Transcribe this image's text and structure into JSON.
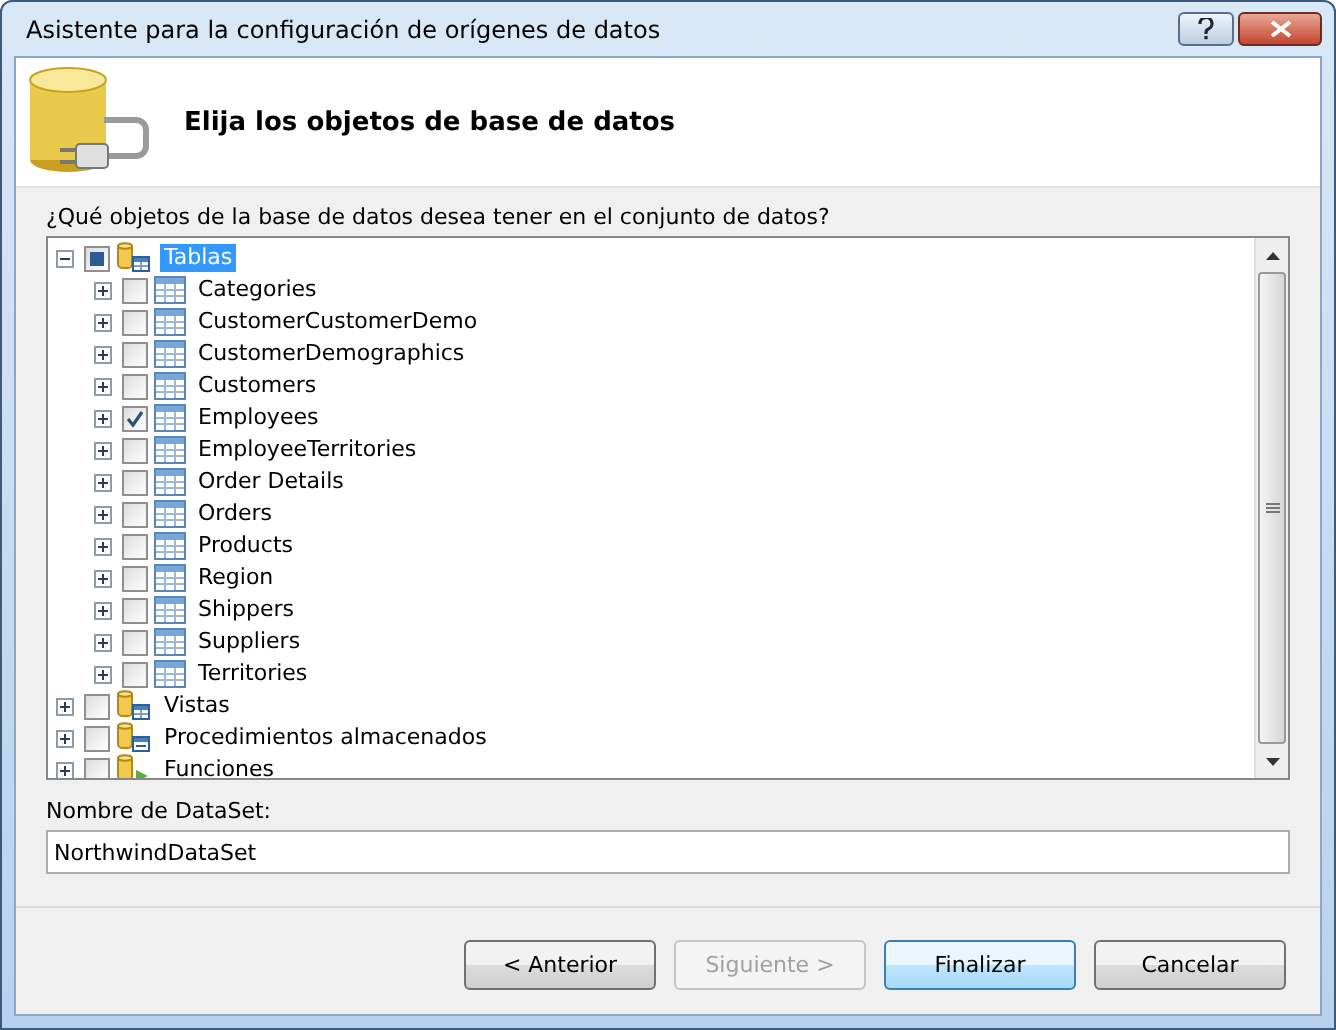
{
  "window": {
    "title": "Asistente para la configuración de orígenes de datos"
  },
  "header": {
    "title": "Elija los objetos de base de datos"
  },
  "prompt": "¿Qué objetos de la base de datos desea tener en el conjunto de datos?",
  "tree": [
    {
      "label": "Tablas",
      "kind": "tables",
      "expanded": true,
      "checked": false,
      "indeterminate": true,
      "selected": true,
      "children": [
        {
          "label": "Categories",
          "checked": false,
          "expanded": false,
          "selected": false
        },
        {
          "label": "CustomerCustomerDemo",
          "checked": false,
          "expanded": false,
          "selected": false
        },
        {
          "label": "CustomerDemographics",
          "checked": false,
          "expanded": false,
          "selected": false
        },
        {
          "label": "Customers",
          "checked": false,
          "expanded": false,
          "selected": false
        },
        {
          "label": "Employees",
          "checked": true,
          "expanded": false,
          "selected": false
        },
        {
          "label": "EmployeeTerritories",
          "checked": false,
          "expanded": false,
          "selected": false
        },
        {
          "label": "Order Details",
          "checked": false,
          "expanded": false,
          "selected": false
        },
        {
          "label": "Orders",
          "checked": false,
          "expanded": false,
          "selected": false
        },
        {
          "label": "Products",
          "checked": false,
          "expanded": false,
          "selected": false
        },
        {
          "label": "Region",
          "checked": false,
          "expanded": false,
          "selected": false
        },
        {
          "label": "Shippers",
          "checked": false,
          "expanded": false,
          "selected": false
        },
        {
          "label": "Suppliers",
          "checked": false,
          "expanded": false,
          "selected": false
        },
        {
          "label": "Territories",
          "checked": false,
          "expanded": false,
          "selected": false
        }
      ]
    },
    {
      "label": "Vistas",
      "kind": "views",
      "expanded": false,
      "checked": false,
      "indeterminate": false,
      "selected": false
    },
    {
      "label": "Procedimientos almacenados",
      "kind": "procedures",
      "expanded": false,
      "checked": false,
      "indeterminate": false,
      "selected": false
    },
    {
      "label": "Funciones",
      "kind": "functions",
      "expanded": false,
      "checked": false,
      "indeterminate": false,
      "selected": false
    }
  ],
  "dataset": {
    "label": "Nombre de DataSet:",
    "value": "NorthwindDataSet"
  },
  "buttons": [
    {
      "label": "< Anterior",
      "disabled": false,
      "default": false
    },
    {
      "label": "Siguiente >",
      "disabled": true,
      "default": false
    },
    {
      "label": "Finalizar",
      "disabled": false,
      "default": true
    },
    {
      "label": "Cancelar",
      "disabled": false,
      "default": false
    }
  ]
}
